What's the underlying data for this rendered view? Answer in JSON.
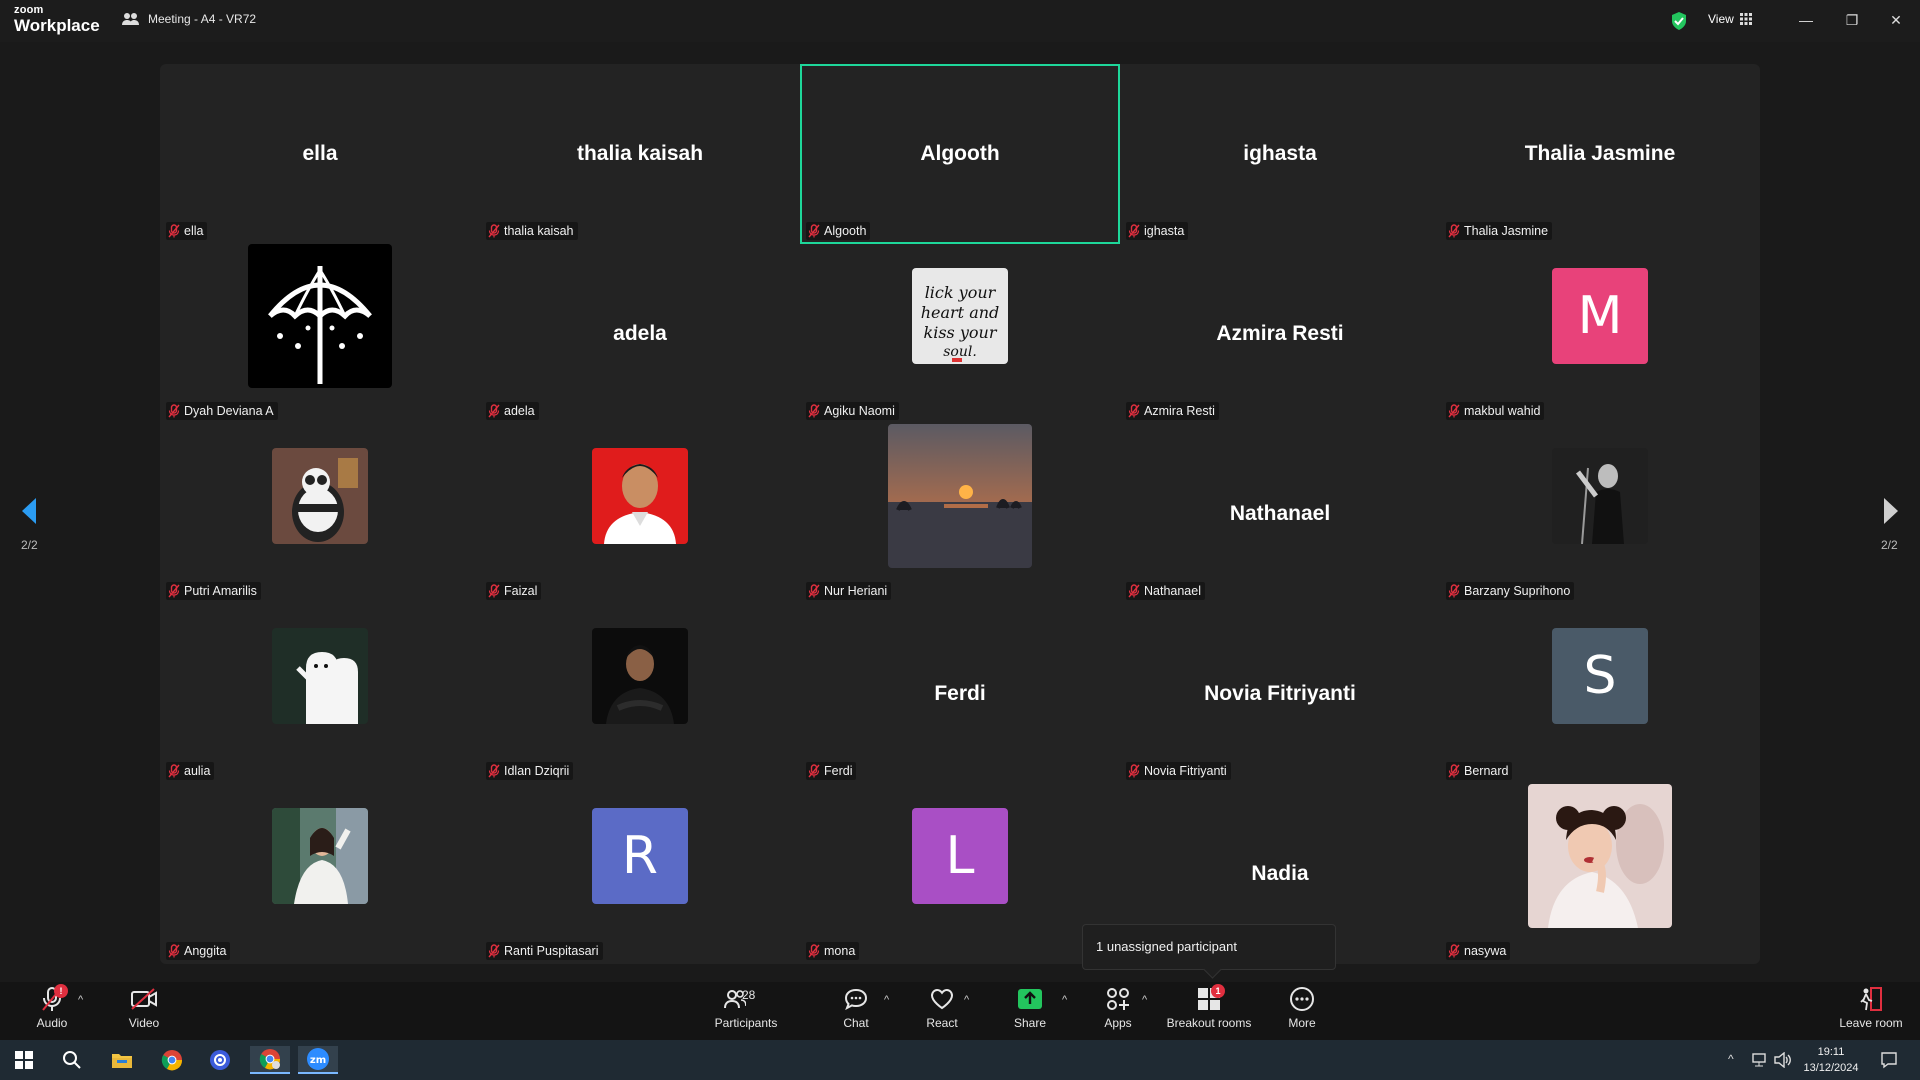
{
  "app": {
    "logo_line1": "zoom",
    "logo_line2": "Workplace",
    "meeting_title": "Meeting - A4 - VR72",
    "view_label": "View"
  },
  "pagination": {
    "left": "2/2",
    "right": "2/2"
  },
  "tiles": [
    {
      "name": "ella",
      "type": "name"
    },
    {
      "name": "thalia kaisah",
      "type": "name"
    },
    {
      "name": "Algooth",
      "type": "name",
      "active": true
    },
    {
      "name": "ighasta",
      "type": "name"
    },
    {
      "name": "Thalia Jasmine",
      "type": "name"
    },
    {
      "name": "Dyah Deviana A",
      "type": "photo",
      "photo": "umbrella-logo"
    },
    {
      "name": "adela",
      "type": "name"
    },
    {
      "name": "Agiku Naomi",
      "type": "photo",
      "photo": "text-shirt"
    },
    {
      "name": "Azmira Resti",
      "type": "name"
    },
    {
      "name": "makbul wahid",
      "type": "letter",
      "letter": "M",
      "color": "#e8427a"
    },
    {
      "name": "Putri Amarilis",
      "type": "photo",
      "photo": "panda-cartoon"
    },
    {
      "name": "Faizal",
      "type": "photo",
      "photo": "red-portrait"
    },
    {
      "name": "Nur Heriani",
      "type": "photo",
      "photo": "sunset"
    },
    {
      "name": "Nathanael",
      "type": "name"
    },
    {
      "name": "Barzany Suprihono",
      "type": "photo",
      "photo": "bw-singer"
    },
    {
      "name": "aulia",
      "type": "photo",
      "photo": "ghosts"
    },
    {
      "name": "Idlan Dziqrii",
      "type": "photo",
      "photo": "dark-portrait"
    },
    {
      "name": "Ferdi",
      "type": "name"
    },
    {
      "name": "Novia Fitriyanti",
      "type": "name"
    },
    {
      "name": "Bernard",
      "type": "letter",
      "letter": "S",
      "color": "#4a5a68"
    },
    {
      "name": "Anggita",
      "type": "photo",
      "photo": "girl-white"
    },
    {
      "name": "Ranti Puspitasari",
      "type": "letter",
      "letter": "R",
      "color": "#5b6bc6"
    },
    {
      "name": "mona",
      "type": "letter",
      "letter": "L",
      "color": "#a94fc5"
    },
    {
      "name": "Nadia",
      "type": "name"
    },
    {
      "name": "nasywa",
      "type": "photo",
      "photo": "vintage-woman"
    }
  ],
  "tooltip": "1 unassigned participant",
  "toolbar": {
    "audio": "Audio",
    "video": "Video",
    "participants": "Participants",
    "participants_count": "28",
    "chat": "Chat",
    "react": "React",
    "share": "Share",
    "apps": "Apps",
    "breakout": "Breakout rooms",
    "breakout_badge": "1",
    "more": "More",
    "leave": "Leave room",
    "audio_badge": "!"
  },
  "taskbar": {
    "time": "19:11",
    "date": "13/12/2024"
  },
  "colors": {
    "active_speaker": "#1ed79a",
    "share_green": "#23c55e",
    "badge_red": "#e02f3f"
  }
}
